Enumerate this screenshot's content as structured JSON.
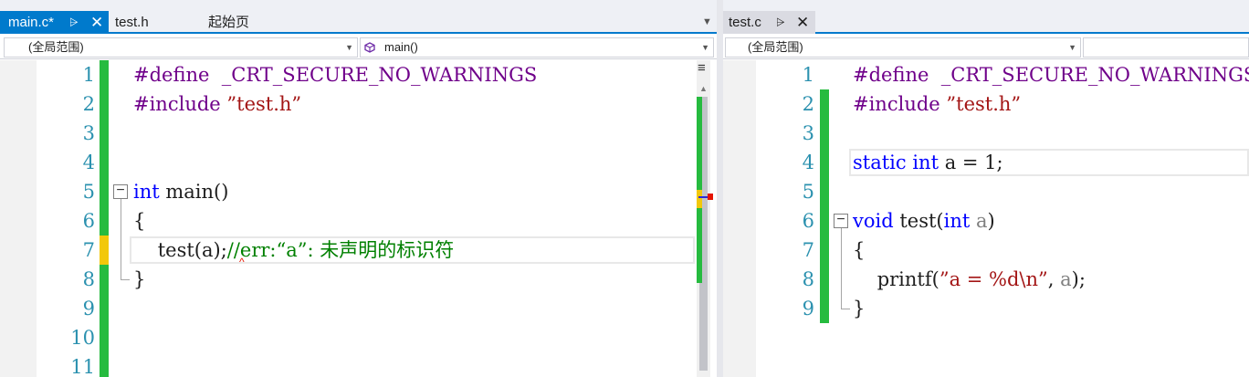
{
  "left": {
    "tabs": [
      {
        "label": "main.c*",
        "state": "active"
      },
      {
        "label": "test.h",
        "state": "inactive"
      },
      {
        "label": "起始页",
        "state": "inactive"
      }
    ],
    "scope_combo": "(全局范围)",
    "member_combo": "main()",
    "lines": [
      {
        "n": "1",
        "tokens": [
          {
            "t": "#define",
            "c": "pp"
          },
          {
            "t": "  _CRT_SECURE_NO_WARNINGS",
            "c": "pp"
          }
        ]
      },
      {
        "n": "2",
        "tokens": [
          {
            "t": "#include",
            "c": "pp"
          },
          {
            "t": " ",
            "c": ""
          },
          {
            "t": "”test.h”",
            "c": "str"
          }
        ]
      },
      {
        "n": "3",
        "tokens": []
      },
      {
        "n": "4",
        "tokens": []
      },
      {
        "n": "5",
        "tokens": [
          {
            "t": "int",
            "c": "kw"
          },
          {
            "t": " main()",
            "c": ""
          }
        ]
      },
      {
        "n": "6",
        "tokens": [
          {
            "t": "{",
            "c": ""
          }
        ]
      },
      {
        "n": "7",
        "tokens": [
          {
            "t": "    test(a);",
            "c": ""
          },
          {
            "t": "//err:“a”: 未声明的标识符",
            "c": "cm"
          }
        ]
      },
      {
        "n": "8",
        "tokens": [
          {
            "t": "}",
            "c": ""
          }
        ]
      },
      {
        "n": "9",
        "tokens": []
      },
      {
        "n": "10",
        "tokens": []
      },
      {
        "n": "11",
        "tokens": []
      }
    ]
  },
  "right": {
    "tabs": [
      {
        "label": "test.c",
        "state": "other-active"
      }
    ],
    "scope_combo": "(全局范围)",
    "member_combo": "",
    "lines": [
      {
        "n": "1",
        "tokens": [
          {
            "t": "#define",
            "c": "pp"
          },
          {
            "t": "  _CRT_SECURE_NO_WARNINGS",
            "c": "pp"
          }
        ]
      },
      {
        "n": "2",
        "tokens": [
          {
            "t": "#include",
            "c": "pp"
          },
          {
            "t": " ",
            "c": ""
          },
          {
            "t": "”test.h”",
            "c": "str"
          }
        ]
      },
      {
        "n": "3",
        "tokens": []
      },
      {
        "n": "4",
        "tokens": [
          {
            "t": "static",
            "c": "kw"
          },
          {
            "t": " ",
            "c": ""
          },
          {
            "t": "int",
            "c": "kw"
          },
          {
            "t": " a = 1;",
            "c": ""
          }
        ]
      },
      {
        "n": "5",
        "tokens": []
      },
      {
        "n": "6",
        "tokens": [
          {
            "t": "void",
            "c": "kw"
          },
          {
            "t": " test(",
            "c": ""
          },
          {
            "t": "int",
            "c": "kw"
          },
          {
            "t": " ",
            "c": ""
          },
          {
            "t": "a",
            "c": "gray"
          },
          {
            "t": ")",
            "c": ""
          }
        ]
      },
      {
        "n": "7",
        "tokens": [
          {
            "t": "{",
            "c": ""
          }
        ]
      },
      {
        "n": "8",
        "tokens": [
          {
            "t": "    printf(",
            "c": ""
          },
          {
            "t": "”a = %d\\n”",
            "c": "str"
          },
          {
            "t": ", ",
            "c": ""
          },
          {
            "t": "a",
            "c": "gray"
          },
          {
            "t": ");",
            "c": ""
          }
        ]
      },
      {
        "n": "9",
        "tokens": [
          {
            "t": "}",
            "c": ""
          }
        ]
      }
    ]
  },
  "icons": {
    "pin": "pin-icon",
    "close": "close-icon",
    "dropdown": "chevron-down-icon",
    "method": "method-cube-icon",
    "split": "split-view-icon",
    "fold": "collapse-icon"
  },
  "colors": {
    "accent": "#007acc",
    "keyword": "#0000ff",
    "preprocessor": "#6f008a",
    "string": "#a31515",
    "comment": "#008000",
    "line_number": "#2b91af",
    "change_saved": "#26bb3f",
    "change_unsaved": "#f2c80a",
    "error": "#e51400"
  }
}
